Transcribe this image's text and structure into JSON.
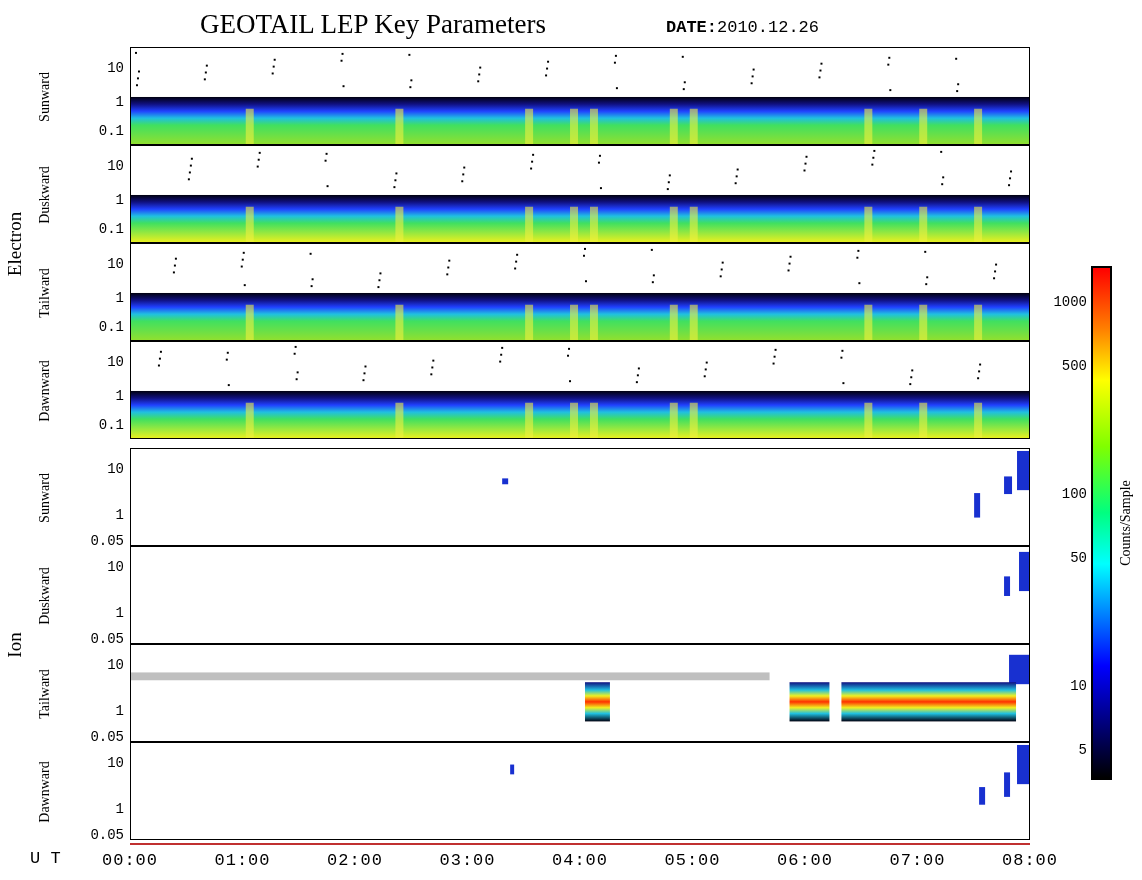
{
  "title": "GEOTAIL LEP Key Parameters",
  "date": "**DATE:**2010.12.26",
  "groups": [
    {
      "label": "Electron",
      "kind": "electron",
      "panels": [
        {
          "label": "Sunward",
          "yticks": [
            "10",
            "1",
            "0.1"
          ]
        },
        {
          "label": "Duskward",
          "yticks": [
            "10",
            "1",
            "0.1"
          ]
        },
        {
          "label": "Tailward",
          "yticks": [
            "10",
            "1",
            "0.1"
          ]
        },
        {
          "label": "Dawnward",
          "yticks": [
            "10",
            "1",
            "0.1"
          ]
        }
      ]
    },
    {
      "label": "Ion",
      "kind": "ion",
      "panels": [
        {
          "label": "Sunward",
          "yticks": [
            "10",
            "1",
            "0.05"
          ]
        },
        {
          "label": "Duskward",
          "yticks": [
            "10",
            "1",
            "0.05"
          ]
        },
        {
          "label": "Tailward",
          "yticks": [
            "10",
            "1",
            "0.05"
          ]
        },
        {
          "label": "Dawnward",
          "yticks": [
            "10",
            "1",
            "0.05"
          ]
        }
      ]
    }
  ],
  "x_axis": {
    "label": "U T",
    "ticks": [
      "00:00",
      "01:00",
      "02:00",
      "03:00",
      "04:00",
      "05:00",
      "06:00",
      "07:00",
      "08:00"
    ]
  },
  "colorbar": {
    "label": "Counts/Sample",
    "ticks": [
      "1000",
      "500",
      "100",
      "50",
      "10",
      "5"
    ]
  }
}
